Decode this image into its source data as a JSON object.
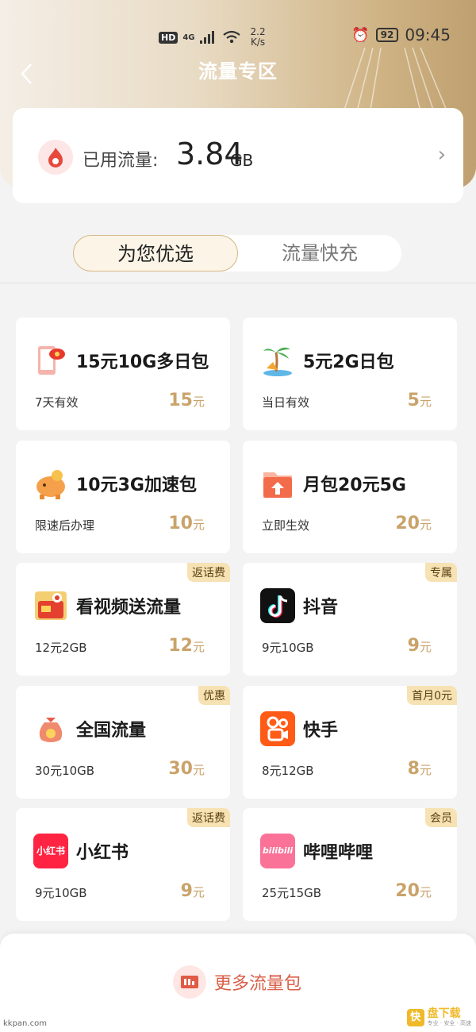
{
  "status_bar": {
    "hd": "HD",
    "network": "4G",
    "net_speed_value": "2.2",
    "net_speed_unit": "K/s",
    "battery": "92",
    "time": "09:45"
  },
  "header": {
    "back_icon": "chevron-left-icon",
    "title": "流量专区"
  },
  "usage": {
    "icon": "flame-icon",
    "label": "已用流量:",
    "value": "3.84",
    "unit": "GB",
    "chevron": "›"
  },
  "tabs": [
    {
      "label": "为您优选",
      "active": true
    },
    {
      "label": "流量快充",
      "active": false
    }
  ],
  "packages": [
    {
      "icon": "phone-gift-icon",
      "title": "15元10G多日包",
      "sub": "7天有效",
      "price": "15",
      "unit": "元",
      "tag": ""
    },
    {
      "icon": "palm-tree-icon",
      "title": "5元2G日包",
      "sub": "当日有效",
      "price": "5",
      "unit": "元",
      "tag": ""
    },
    {
      "icon": "piggy-bank-icon",
      "title": "10元3G加速包",
      "sub": "限速后办理",
      "price": "10",
      "unit": "元",
      "tag": ""
    },
    {
      "icon": "folder-up-icon",
      "title": "月包20元5G",
      "sub": "立即生效",
      "price": "20",
      "unit": "元",
      "tag": ""
    },
    {
      "icon": "video-gift-icon",
      "title": "看视频送流量",
      "sub": "12元2GB",
      "price": "12",
      "unit": "元",
      "tag": "返话费"
    },
    {
      "icon": "douyin-icon",
      "title": "抖音",
      "sub": "9元10GB",
      "price": "9",
      "unit": "元",
      "tag": "专属"
    },
    {
      "icon": "money-bag-icon",
      "title": "全国流量",
      "sub": "30元10GB",
      "price": "30",
      "unit": "元",
      "tag": "优惠"
    },
    {
      "icon": "kuaishou-icon",
      "title": "快手",
      "sub": "8元12GB",
      "price": "8",
      "unit": "元",
      "tag": "首月0元"
    },
    {
      "icon": "xiaohongshu-icon",
      "title": "小红书",
      "sub": "9元10GB",
      "price": "9",
      "unit": "元",
      "tag": "返话费"
    },
    {
      "icon": "bilibili-icon",
      "title": "哔哩哔哩",
      "sub": "25元15GB",
      "price": "20",
      "unit": "元",
      "tag": "会员"
    }
  ],
  "xhs_logo_text": "小红书",
  "bili_logo_text": "bilibili",
  "more": {
    "icon": "package-icon",
    "label": "更多流量包"
  },
  "watermark": {
    "left": "kkpan.com",
    "right_logo": "快",
    "right_text": "盘下载",
    "right_sub": "专业 · 安全 · 高速"
  },
  "colors": {
    "accent_gold": "#c9a36a",
    "tag_bg": "#f6e2b3",
    "more_red": "#d9604a"
  }
}
